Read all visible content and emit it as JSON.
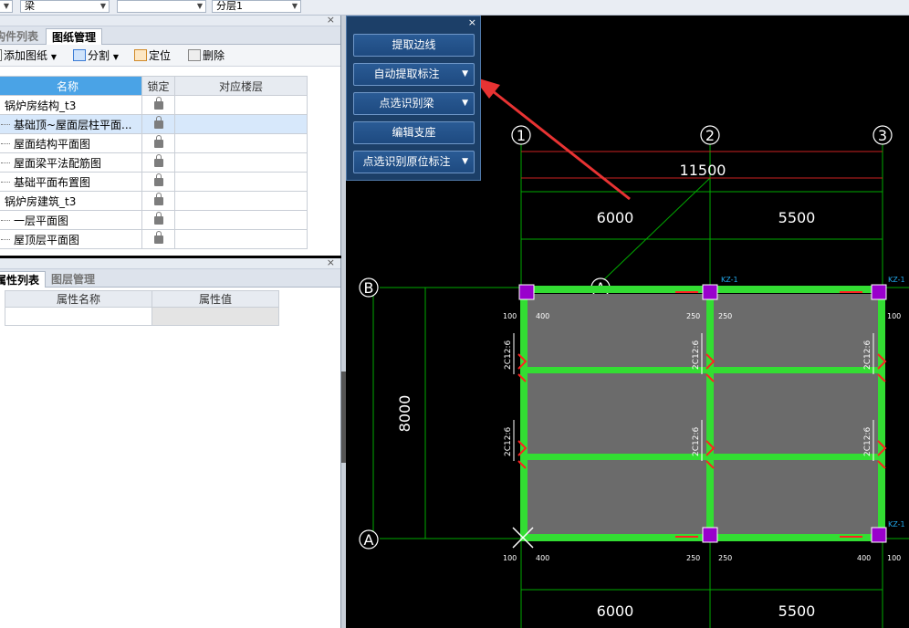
{
  "topbar": {
    "combo1": "",
    "combo2": "梁",
    "combo3": "",
    "combo4": "分层1"
  },
  "drawing_panel": {
    "tabs": [
      "构件列表",
      "图纸管理"
    ],
    "toolbar": {
      "add": "添加图纸",
      "split": "分割",
      "locate": "定位",
      "delete": "删除"
    },
    "columns": [
      "名称",
      "锁定",
      "对应楼层"
    ],
    "rows": [
      {
        "name": "锅炉房结构_t3",
        "indent": false
      },
      {
        "name": "基础顶~屋面层柱平面...",
        "indent": true,
        "selected": true
      },
      {
        "name": "屋面结构平面图",
        "indent": true
      },
      {
        "name": "屋面梁平法配筋图",
        "indent": true
      },
      {
        "name": "基础平面布置图",
        "indent": true
      },
      {
        "name": "锅炉房建筑_t3",
        "indent": false
      },
      {
        "name": "一层平面图",
        "indent": true
      },
      {
        "name": "屋顶层平面图",
        "indent": true
      }
    ]
  },
  "property_panel": {
    "tabs": [
      "属性列表",
      "图层管理"
    ],
    "columns": [
      "属性名称",
      "属性值"
    ]
  },
  "float_menu": {
    "buttons": [
      {
        "label": "提取边线",
        "dropdown": false
      },
      {
        "label": "自动提取标注",
        "dropdown": true
      },
      {
        "label": "点选识别梁",
        "dropdown": true
      },
      {
        "label": "编辑支座",
        "dropdown": false
      },
      {
        "label": "点选识别原位标注",
        "dropdown": true
      }
    ]
  },
  "cad": {
    "axis_numbers": [
      "1",
      "2",
      "3"
    ],
    "axis_letters": [
      "B",
      "A",
      "A"
    ],
    "dim_total": "11500",
    "dim_left": "6000",
    "dim_right": "5500",
    "dim_left_bottom": "6000",
    "dim_right_bottom": "5500",
    "dim_vertical": "8000",
    "column_tag": "KZ-1",
    "beam_label": "2C12:6",
    "small_dims": [
      "100",
      "400",
      "250",
      "250"
    ],
    "colors": {
      "beam": "#33dd33",
      "column": "#9900cc",
      "axis": "#00cc00",
      "annot": "#ff2222",
      "slab": "#6b6b6b"
    }
  }
}
